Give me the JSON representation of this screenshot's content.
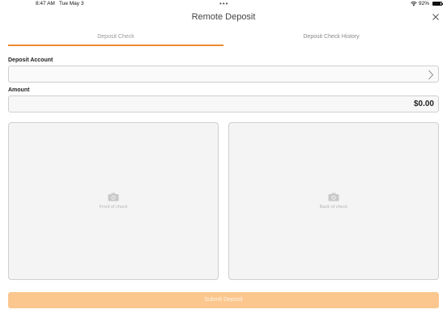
{
  "status_bar": {
    "time": "8:47 AM",
    "date": "Tue May 3",
    "dots": "•••",
    "battery": "92%"
  },
  "header": {
    "title": "Remote Deposit",
    "close_icon": "close-icon"
  },
  "tabs": [
    {
      "label": "Deposit Check",
      "active": true
    },
    {
      "label": "Deposit Check History",
      "active": false
    }
  ],
  "form": {
    "account_label": "Deposit Account",
    "account_value": "",
    "amount_label": "Amount",
    "amount_value": "$0.00"
  },
  "check_images": {
    "front_caption": "Front of check",
    "back_caption": "Back of check",
    "icon": "camera-icon"
  },
  "submit": {
    "label": "Submit Deposit",
    "enabled": false
  },
  "colors": {
    "accent": "#ec8a2f",
    "submit_disabled": "#fbc78f"
  }
}
